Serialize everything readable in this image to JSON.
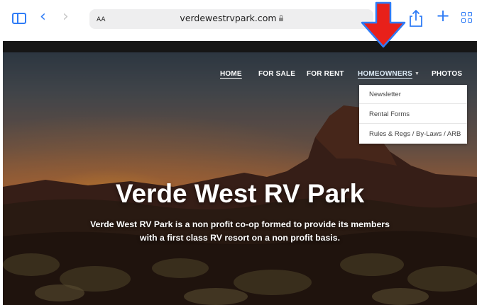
{
  "browser": {
    "aa_label": "AA",
    "url": "verdewestrvpark.com",
    "icons": [
      "sidebar-icon",
      "back-icon",
      "forward-icon",
      "lock-icon",
      "share-icon",
      "plus-icon",
      "tabs-grid-icon"
    ],
    "accent_color": "#2f7cf6"
  },
  "nav": {
    "items": [
      {
        "label": "HOME"
      },
      {
        "label": "FOR SALE"
      },
      {
        "label": "FOR RENT"
      },
      {
        "label": "HOMEOWNERS"
      },
      {
        "label": "PHOTOS"
      }
    ],
    "dropdown": [
      "Newsletter",
      "Rental Forms",
      "Rules & Regs / By-Laws / ARB"
    ]
  },
  "hero": {
    "title": "Verde West RV Park",
    "subtitle": "Verde West RV Park is a non profit co-op formed to provide its members with a first class RV resort on a non profit basis."
  },
  "annotation": {
    "arrow_color": "#e8201a"
  }
}
